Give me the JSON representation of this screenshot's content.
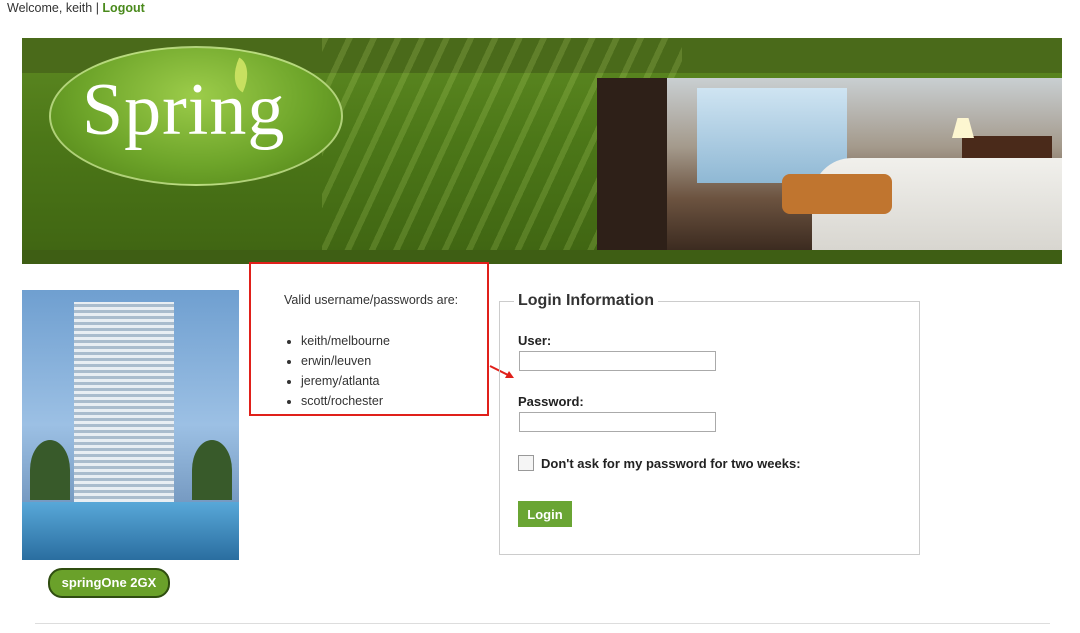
{
  "header": {
    "welcome_text": "Welcome, keith | ",
    "logout_label": "Logout"
  },
  "banner": {
    "logo_text": "Spring"
  },
  "badge": {
    "text": "springOne 2GX"
  },
  "hints": {
    "title": "Valid username/passwords are:",
    "credentials": [
      "keith/melbourne",
      "erwin/leuven",
      "jeremy/atlanta",
      "scott/rochester"
    ]
  },
  "login": {
    "legend": "Login Information",
    "user_label": "User:",
    "user_value": "",
    "password_label": "Password:",
    "password_value": "",
    "remember_label": "Don't ask for my password for two weeks:",
    "remember_checked": false,
    "submit_label": "Login"
  },
  "colors": {
    "accent": "#6aa534",
    "link": "#4a8a1c",
    "highlight_border": "#e0201a"
  }
}
